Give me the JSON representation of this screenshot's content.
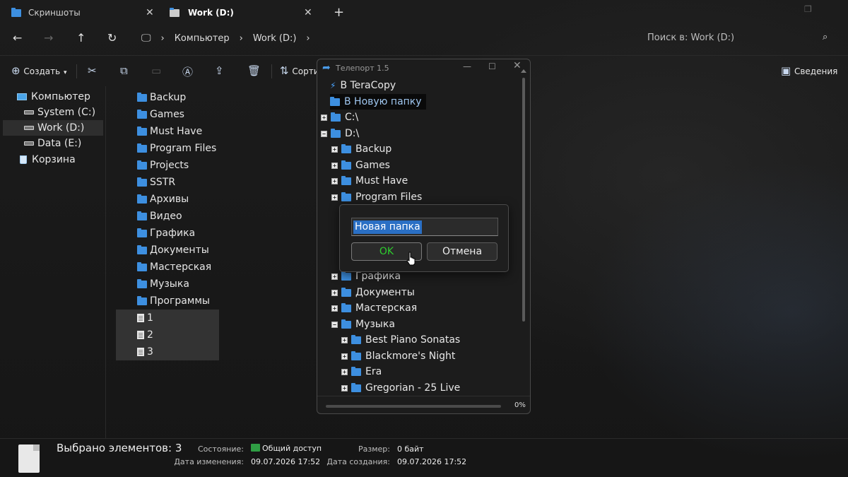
{
  "tabs": [
    {
      "label": "Скриншоты",
      "active": false
    },
    {
      "label": "Work (D:)",
      "active": true
    }
  ],
  "breadcrumbs": [
    "Компьютер",
    "Work (D:)"
  ],
  "search": {
    "placeholder": "Поиск в: Work (D:)"
  },
  "toolbar": {
    "create_label": "Создать",
    "sort_label": "Сорти",
    "details_label": "Сведения"
  },
  "nav_pane": [
    {
      "label": "Компьютер",
      "icon": "computer-icon"
    },
    {
      "label": "System (C:)",
      "icon": "drive-icon"
    },
    {
      "label": "Work (D:)",
      "icon": "drive-icon",
      "selected": true
    },
    {
      "label": "Data (E:)",
      "icon": "drive-icon"
    },
    {
      "label": "Корзина",
      "icon": "recycle-bin-icon"
    }
  ],
  "files": [
    {
      "name": "Backup",
      "type": "folder"
    },
    {
      "name": "Games",
      "type": "folder"
    },
    {
      "name": "Must Have",
      "type": "folder"
    },
    {
      "name": "Program Files",
      "type": "folder"
    },
    {
      "name": "Projects",
      "type": "folder"
    },
    {
      "name": "SSTR",
      "type": "folder"
    },
    {
      "name": "Архивы",
      "type": "folder"
    },
    {
      "name": "Видео",
      "type": "folder"
    },
    {
      "name": "Графика",
      "type": "folder"
    },
    {
      "name": "Документы",
      "type": "folder"
    },
    {
      "name": "Мастерская",
      "type": "folder"
    },
    {
      "name": "Музыка",
      "type": "folder"
    },
    {
      "name": "Программы",
      "type": "folder"
    },
    {
      "name": "1",
      "type": "file",
      "selected": true
    },
    {
      "name": "2",
      "type": "file",
      "selected": true
    },
    {
      "name": "3",
      "type": "file",
      "selected": true
    }
  ],
  "teleport": {
    "title": "Телепорт 1.5",
    "tree": [
      {
        "label": "В TeraCopy",
        "kind": "action"
      },
      {
        "label": "В Новую папку",
        "kind": "action-folder"
      },
      {
        "label": "C:\\",
        "kind": "node",
        "expander": "+"
      },
      {
        "label": "D:\\",
        "kind": "node",
        "expander": "−"
      },
      {
        "label": "Backup",
        "kind": "node",
        "expander": "+"
      },
      {
        "label": "Games",
        "kind": "node",
        "expander": "+"
      },
      {
        "label": "Must Have",
        "kind": "node",
        "expander": "+"
      },
      {
        "label": "Program Files",
        "kind": "node",
        "expander": "+"
      },
      {
        "label": "Графика",
        "kind": "node",
        "expander": "+"
      },
      {
        "label": "Документы",
        "kind": "node",
        "expander": "+"
      },
      {
        "label": "Мастерская",
        "kind": "node",
        "expander": "+"
      },
      {
        "label": "Музыка",
        "kind": "node",
        "expander": "−"
      },
      {
        "label": "Best Piano Sonatas",
        "kind": "node",
        "expander": "+"
      },
      {
        "label": "Blackmore's Night",
        "kind": "node",
        "expander": "+"
      },
      {
        "label": "Era",
        "kind": "node",
        "expander": "+"
      },
      {
        "label": "Gregorian - 25 Live",
        "kind": "node",
        "expander": "+"
      }
    ],
    "progress_label": "0%",
    "progress": 0
  },
  "dialog": {
    "input_value": "Новая папка",
    "ok_label": "OK",
    "cancel_label": "Отмена"
  },
  "details": {
    "selected_count": "Выбрано элементов: 3",
    "state_label": "Состояние:",
    "state_value": "Общий доступ",
    "modified_label": "Дата изменения:",
    "modified_value": "09.07.2026 17:52",
    "size_label": "Размер:",
    "size_value": "0 байт",
    "created_label": "Дата создания:",
    "created_value": "09.07.2026 17:52"
  },
  "colors": {
    "accent": "#3d8fe0",
    "ok_text": "#2ecc2e",
    "selection": "#2a6fc4"
  }
}
